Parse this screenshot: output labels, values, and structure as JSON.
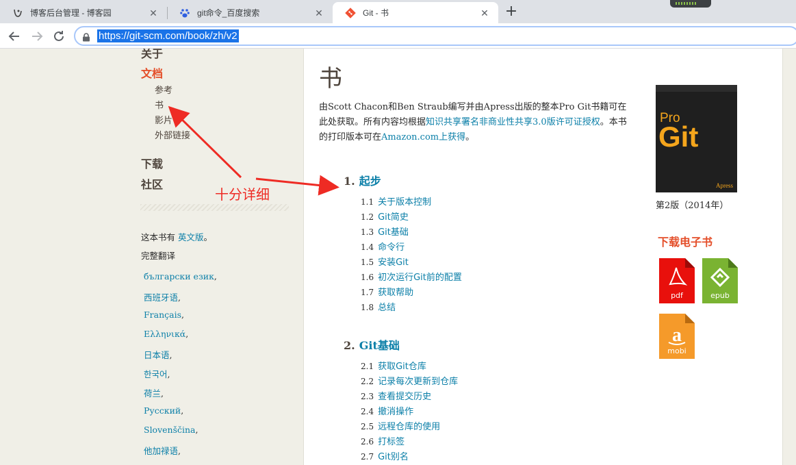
{
  "browser": {
    "tabs": [
      {
        "title": "博客后台管理 - 博客园",
        "active": false
      },
      {
        "title": "git命令_百度搜索",
        "active": false
      },
      {
        "title": "Git - 书",
        "active": true
      }
    ],
    "url": "https://git-scm.com/book/zh/v2",
    "new_tab_label": "+"
  },
  "sidebar": {
    "nav": [
      {
        "label": "关于",
        "active": false
      },
      {
        "label": "文档",
        "active": true
      },
      {
        "label": "下载",
        "active": false
      },
      {
        "label": "社区",
        "active": false
      }
    ],
    "doc_sub": [
      "参考",
      "书",
      "影片",
      "外部链接"
    ],
    "note_prefix": "这本书有 ",
    "note_link": "英文版",
    "note_suffix": "。",
    "full_translations_label": "完整翻译",
    "languages": [
      "български език",
      "西班牙语",
      "Français",
      "Ελληνικά",
      "日本语",
      "한국어",
      "荷兰",
      "Русский",
      "Slovenščina",
      "他加禄语"
    ],
    "comma": ","
  },
  "main": {
    "title": "书",
    "intro_1": "由Scott Chacon和Ben Straub编写并由Apress出版的整本Pro Git书籍可在此处获取。所有内容均根据",
    "intro_link1": "知识共享署名非商业性共享3.0版许可证授权",
    "intro_2": "。本书的打印版本可在",
    "intro_link2": "Amazon.com上获得",
    "intro_3": "。",
    "chapters": [
      {
        "num": "1.",
        "title": "起步",
        "sections": [
          {
            "num": "1.1",
            "title": "关于版本控制"
          },
          {
            "num": "1.2",
            "title": "Git简史"
          },
          {
            "num": "1.3",
            "title": "Git基础"
          },
          {
            "num": "1.4",
            "title": "命令行"
          },
          {
            "num": "1.5",
            "title": "安装Git"
          },
          {
            "num": "1.6",
            "title": "初次运行Git前的配置"
          },
          {
            "num": "1.7",
            "title": "获取帮助"
          },
          {
            "num": "1.8",
            "title": "总结"
          }
        ]
      },
      {
        "num": "2.",
        "title": "Git基础",
        "sections": [
          {
            "num": "2.1",
            "title": "获取Git仓库"
          },
          {
            "num": "2.2",
            "title": "记录每次更新到仓库"
          },
          {
            "num": "2.3",
            "title": "查看提交历史"
          },
          {
            "num": "2.4",
            "title": "撤消操作"
          },
          {
            "num": "2.5",
            "title": "远程仓库的使用"
          },
          {
            "num": "2.6",
            "title": "打标签"
          },
          {
            "num": "2.7",
            "title": "Git别名"
          }
        ]
      }
    ]
  },
  "aside": {
    "cover_pro": "Pro",
    "cover_git": "Git",
    "cover_publisher": "Apress",
    "edition": "第2版（2014年）",
    "download_title": "下载电子书",
    "downloads": [
      {
        "label": "pdf",
        "color": "#e8100c"
      },
      {
        "label": "epub",
        "color": "#7ab332"
      },
      {
        "label": "mobi",
        "color": "#f59a2a"
      }
    ]
  },
  "annotation": {
    "text": "十分详细",
    "color": "#ee2b24"
  }
}
